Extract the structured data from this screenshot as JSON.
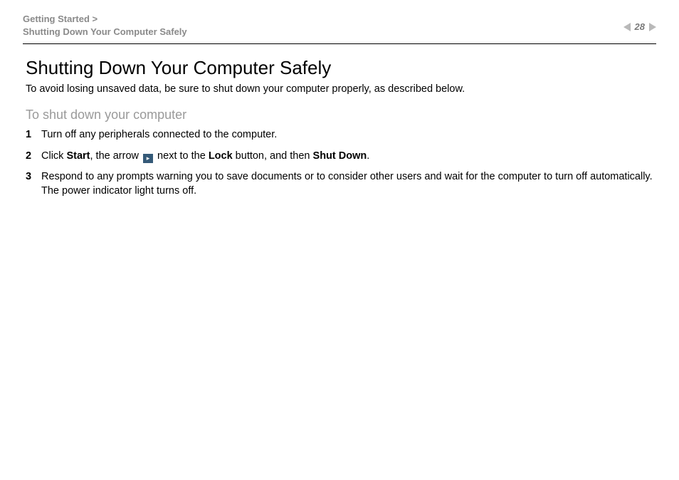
{
  "header": {
    "breadcrumb_line1": "Getting Started >",
    "breadcrumb_line2": "Shutting Down Your Computer Safely",
    "page_number": "28"
  },
  "content": {
    "title": "Shutting Down Your Computer Safely",
    "intro": "To avoid losing unsaved data, be sure to shut down your computer properly, as described below.",
    "subheading": "To shut down your computer",
    "steps": [
      {
        "num": "1",
        "text": "Turn off any peripherals connected to the computer."
      },
      {
        "num": "2",
        "seg0": "Click ",
        "b0": "Start",
        "seg1": ", the arrow ",
        "seg2": " next to the ",
        "b1": "Lock",
        "seg3": " button, and then ",
        "b2": "Shut Down",
        "seg4": "."
      },
      {
        "num": "3",
        "line1": "Respond to any prompts warning you to save documents or to consider other users and wait for the computer to turn off automatically.",
        "line2": "The power indicator light turns off."
      }
    ]
  }
}
